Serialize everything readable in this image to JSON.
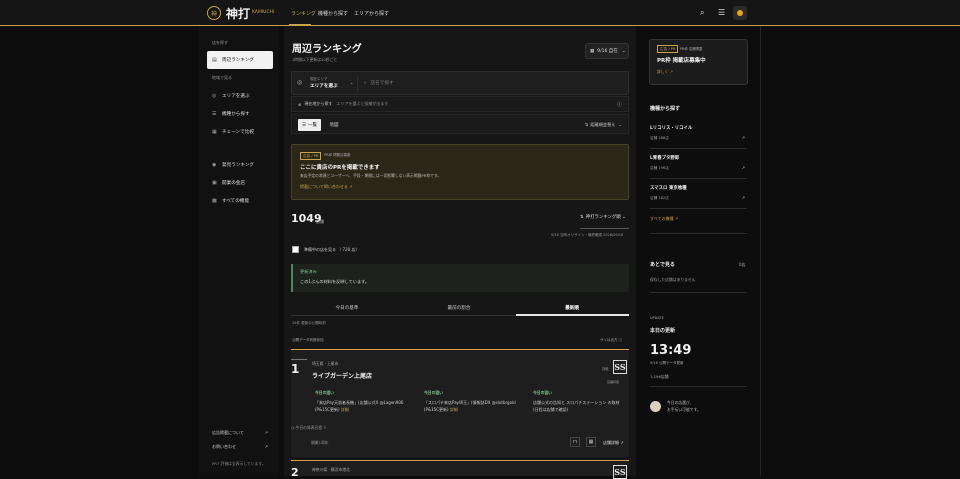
{
  "header": {
    "logo_mark": "神",
    "logo_text": "神打",
    "logo_sub": "KAMIUCHI",
    "nav": [
      "ランキング",
      "機種から探す",
      "エリアから探す"
    ]
  },
  "sidebar": {
    "section1": "店を探す",
    "items1": [
      {
        "label": "周辺ランキング",
        "icon": "▤"
      }
    ],
    "section2": "地域で見る",
    "items2": [
      {
        "label": "エリアを選ぶ",
        "icon": "◎"
      },
      {
        "label": "機種から探す",
        "icon": "☰"
      },
      {
        "label": "チェーンで比較",
        "icon": "▦"
      }
    ],
    "items3": [
      {
        "label": "発見ランキング",
        "icon": "◉"
      },
      {
        "label": "開業の金店",
        "icon": "▣"
      },
      {
        "label": "すべての機能",
        "icon": "▩"
      }
    ],
    "footer": [
      "広告掲載について",
      "お問い合わせ"
    ],
    "note": "PR7 評価は全表示しています。"
  },
  "main": {
    "title": "周辺ランキング",
    "subtitle": "1時間以下更新は10秒ごと",
    "date": "9/16 自在",
    "area_label": "現在エリア",
    "area_value": "エリアを選ぶ",
    "search_placeholder": "店名で探す",
    "curloc_label": "現在地から探す",
    "curloc_sub": "エリアを選ぶと候補が出ます",
    "seg_on": "一覧",
    "seg_off": "地図",
    "sort": "距離順並替え",
    "promo": {
      "badge": "広告 / PR",
      "badge_sub": "PR枠 掲載店募集",
      "title": "ここに貴店のPRを掲載できます",
      "desc": "来店予定の常連とユーザーへ、手段・期間には一切影響しない表示掲載PR枠です。",
      "link": "掲載について問い合わせる"
    },
    "count": "1049",
    "count_unit": "店舗",
    "rank_dd": "神打ランキング順",
    "updated": "9/16 当時オリサイン・最終確認 2026/09/16",
    "filter_label": "準備中の店を見る （ 720 店）",
    "notice_title": "更新済み",
    "notice_desc": "この1ぶんの材料を反映しています。",
    "tabs": [
      "今日の基準",
      "最前の割合",
      "最新順"
    ],
    "note1": "15件 更新の公開時刻",
    "note2": "公開データ判断参加",
    "note3": "サイは出方 ⓘ",
    "card1": {
      "rank": "1",
      "area": "埼玉県 · 上尾市",
      "name": "ライブガーデン上尾店",
      "ss": "SS",
      "ss_label": "評価",
      "ss_sub": "店舗評価",
      "cols": [
        {
          "h": "今日の狙い",
          "d": "「来店Pay天翁者長機」(店舗公式X @Lagen906 (P&15C更新)",
          "link": "詳細"
        },
        {
          "h": "今日の狙い",
          "d": "「スロパチ来店Pay埼玉」(情報誌DX @slotbrgold (P&15C更新)",
          "link": "詳細"
        },
        {
          "h": "今日の狙い",
          "d": "店舗公式の告知と スロパチステーション の取材 (日程は店舗で確認)",
          "link": ""
        }
      ],
      "next": "今日の発表日程 3",
      "foot": "開業1周年",
      "detail": "店舗詳細"
    },
    "card2": {
      "rank": "2",
      "area": "神奈川県 · 横浜市港北",
      "ss": "SS"
    }
  },
  "right": {
    "pr_badge": "広告 / PR",
    "pr_sub": "PR枠 店舗掲載",
    "pr_title": "PR枠 掲載店募集中",
    "pr_link": "詳しく",
    "machines_title": "機種から探す",
    "machines": [
      {
        "name": "Lリコリス・リコイル",
        "count": "店舗 288店"
      },
      {
        "name": "L青春ブタ野郎",
        "count": "店舗 196店"
      },
      {
        "name": "スマスロ 東京喰種",
        "count": "店舗 182店"
      }
    ],
    "all_machines": "すべての機種",
    "later_title": "あとで見る",
    "later_count": "0店",
    "later_desc": "保存した店舗はありません",
    "update_sm": "UPDATE",
    "today": "本日の更新",
    "time": "13:49",
    "time_sub": "9/16 公開データ更新",
    "time_count": "1,196店舗",
    "msg": [
      "今日の店選び、",
      "お手伝い可能です。"
    ]
  }
}
